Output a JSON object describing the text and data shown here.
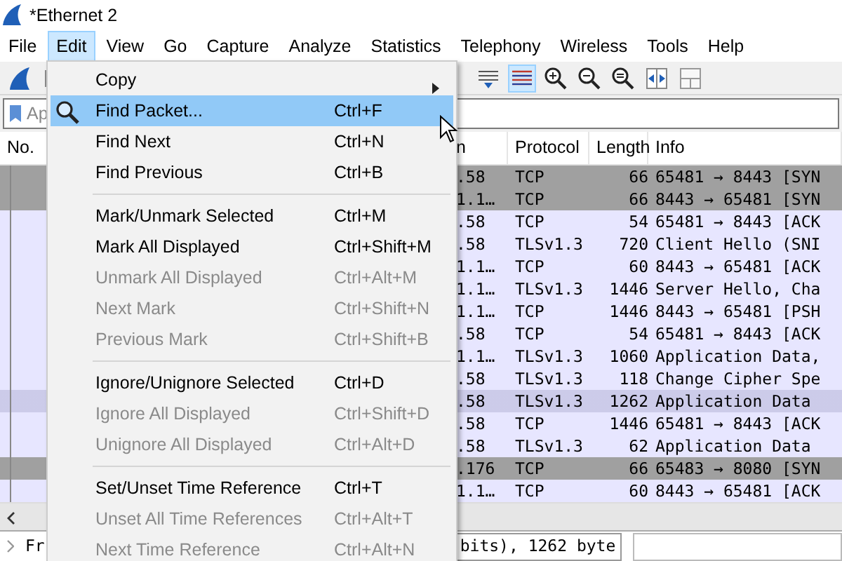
{
  "window": {
    "title": "*Ethernet 2"
  },
  "menubar": [
    {
      "label": "File",
      "selected": false
    },
    {
      "label": "Edit",
      "selected": true
    },
    {
      "label": "View",
      "selected": false
    },
    {
      "label": "Go",
      "selected": false
    },
    {
      "label": "Capture",
      "selected": false
    },
    {
      "label": "Analyze",
      "selected": false
    },
    {
      "label": "Statistics",
      "selected": false
    },
    {
      "label": "Telephony",
      "selected": false
    },
    {
      "label": "Wireless",
      "selected": false
    },
    {
      "label": "Tools",
      "selected": false
    },
    {
      "label": "Help",
      "selected": false
    }
  ],
  "filter": {
    "placeholder": "Ap"
  },
  "table": {
    "columns": [
      "No.",
      "n",
      "Protocol",
      "Length",
      "Info"
    ],
    "rows": [
      {
        "column_2": ".58",
        "protocol": "TCP",
        "length": "66",
        "info": "65481 → 8443 [SYN",
        "color": "#a0a0a0",
        "selected": false
      },
      {
        "column_2": "1.1…",
        "protocol": "TCP",
        "length": "66",
        "info": "8443 → 65481 [SYN",
        "color": "#a0a0a0",
        "selected": false
      },
      {
        "column_2": ".58",
        "protocol": "TCP",
        "length": "54",
        "info": "65481 → 8443 [ACK",
        "color": "#e7e6ff",
        "selected": false
      },
      {
        "column_2": ".58",
        "protocol": "TLSv1.3",
        "length": "720",
        "info": "Client Hello (SNI",
        "color": "#e7e6ff",
        "selected": false
      },
      {
        "column_2": "1.1…",
        "protocol": "TCP",
        "length": "60",
        "info": "8443 → 65481 [ACK",
        "color": "#e7e6ff",
        "selected": false
      },
      {
        "column_2": "1.1…",
        "protocol": "TLSv1.3",
        "length": "1446",
        "info": "Server Hello, Cha",
        "color": "#e7e6ff",
        "selected": false
      },
      {
        "column_2": "1.1…",
        "protocol": "TCP",
        "length": "1446",
        "info": "8443 → 65481 [PSH",
        "color": "#e7e6ff",
        "selected": false
      },
      {
        "column_2": ".58",
        "protocol": "TCP",
        "length": "54",
        "info": "65481 → 8443 [ACK",
        "color": "#e7e6ff",
        "selected": false
      },
      {
        "column_2": "1.1…",
        "protocol": "TLSv1.3",
        "length": "1060",
        "info": "Application Data,",
        "color": "#e7e6ff",
        "selected": false
      },
      {
        "column_2": ".58",
        "protocol": "TLSv1.3",
        "length": "118",
        "info": "Change Cipher Spe",
        "color": "#e7e6ff",
        "selected": false
      },
      {
        "column_2": ".58",
        "protocol": "TLSv1.3",
        "length": "1262",
        "info": "Application Data",
        "color": "#e7e6ff",
        "selected": true
      },
      {
        "column_2": ".58",
        "protocol": "TCP",
        "length": "1446",
        "info": "65481 → 8443 [ACK",
        "color": "#e7e6ff",
        "selected": false
      },
      {
        "column_2": ".58",
        "protocol": "TLSv1.3",
        "length": "62",
        "info": "Application Data",
        "color": "#e7e6ff",
        "selected": false
      },
      {
        "column_2": ".176",
        "protocol": "TCP",
        "length": "66",
        "info": "65483 → 8080 [SYN",
        "color": "#a0a0a0",
        "selected": false
      },
      {
        "column_2": "1.1…",
        "protocol": "TCP",
        "length": "60",
        "info": "8443 → 65481 [ACK",
        "color": "#e7e6ff",
        "selected": false
      }
    ]
  },
  "details": {
    "line_start": "Fr",
    "line_end": "bits), 1262 byte"
  },
  "edit_menu": [
    {
      "kind": "item",
      "label": "Copy",
      "submenu": true,
      "has_icon": false,
      "disabled": false,
      "selected": false
    },
    {
      "kind": "item",
      "label": "Find Packet...",
      "shortcut": "Ctrl+F",
      "submenu": false,
      "has_icon": true,
      "disabled": false,
      "selected": true
    },
    {
      "kind": "item",
      "label": "Find Next",
      "shortcut": "Ctrl+N",
      "submenu": false,
      "has_icon": false,
      "disabled": false,
      "selected": false
    },
    {
      "kind": "item",
      "label": "Find Previous",
      "shortcut": "Ctrl+B",
      "submenu": false,
      "has_icon": false,
      "disabled": false,
      "selected": false
    },
    {
      "kind": "separator"
    },
    {
      "kind": "item",
      "label": "Mark/Unmark Selected",
      "shortcut": "Ctrl+M",
      "submenu": false,
      "has_icon": false,
      "disabled": false,
      "selected": false
    },
    {
      "kind": "item",
      "label": "Mark All Displayed",
      "shortcut": "Ctrl+Shift+M",
      "submenu": false,
      "has_icon": false,
      "disabled": false,
      "selected": false
    },
    {
      "kind": "item",
      "label": "Unmark All Displayed",
      "shortcut": "Ctrl+Alt+M",
      "submenu": false,
      "has_icon": false,
      "disabled": true,
      "selected": false
    },
    {
      "kind": "item",
      "label": "Next Mark",
      "shortcut": "Ctrl+Shift+N",
      "submenu": false,
      "has_icon": false,
      "disabled": true,
      "selected": false
    },
    {
      "kind": "item",
      "label": "Previous Mark",
      "shortcut": "Ctrl+Shift+B",
      "submenu": false,
      "has_icon": false,
      "disabled": true,
      "selected": false
    },
    {
      "kind": "separator"
    },
    {
      "kind": "item",
      "label": "Ignore/Unignore Selected",
      "shortcut": "Ctrl+D",
      "submenu": false,
      "has_icon": false,
      "disabled": false,
      "selected": false
    },
    {
      "kind": "item",
      "label": "Ignore All Displayed",
      "shortcut": "Ctrl+Shift+D",
      "submenu": false,
      "has_icon": false,
      "disabled": true,
      "selected": false
    },
    {
      "kind": "item",
      "label": "Unignore All Displayed",
      "shortcut": "Ctrl+Alt+D",
      "submenu": false,
      "has_icon": false,
      "disabled": true,
      "selected": false
    },
    {
      "kind": "separator"
    },
    {
      "kind": "item",
      "label": "Set/Unset Time Reference",
      "shortcut": "Ctrl+T",
      "submenu": false,
      "has_icon": false,
      "disabled": false,
      "selected": false
    },
    {
      "kind": "item",
      "label": "Unset All Time References",
      "shortcut": "Ctrl+Alt+T",
      "submenu": false,
      "has_icon": false,
      "disabled": true,
      "selected": false
    },
    {
      "kind": "item",
      "label": "Next Time Reference",
      "shortcut": "Ctrl+Alt+N",
      "submenu": false,
      "has_icon": false,
      "disabled": true,
      "selected": false
    }
  ]
}
